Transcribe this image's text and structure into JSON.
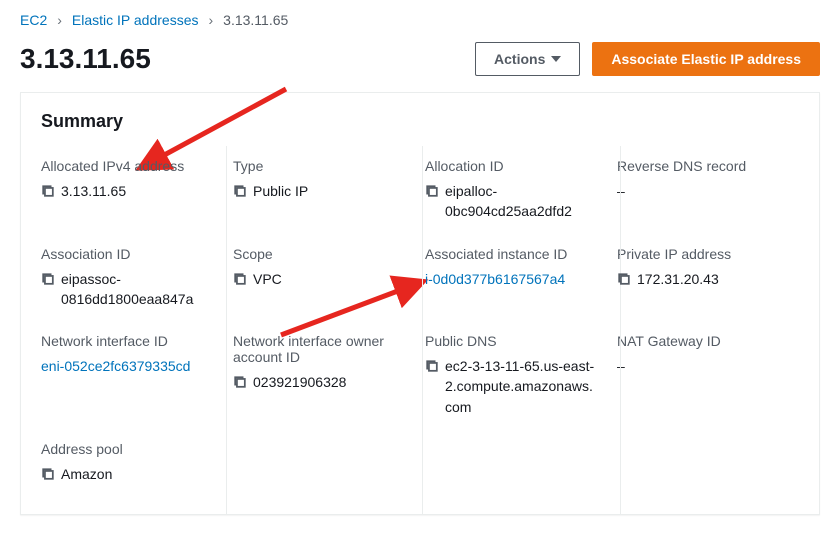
{
  "breadcrumb": {
    "items": [
      {
        "label": "EC2",
        "link": true
      },
      {
        "label": "Elastic IP addresses",
        "link": true
      },
      {
        "label": "3.13.11.65",
        "link": false
      }
    ]
  },
  "header": {
    "title": "3.13.11.65",
    "actions_label": "Actions",
    "associate_label": "Associate Elastic IP address"
  },
  "summary": {
    "title": "Summary",
    "fields": {
      "allocated_ipv4": {
        "label": "Allocated IPv4 address",
        "value": "3.13.11.65",
        "copy": true
      },
      "type": {
        "label": "Type",
        "value": "Public IP",
        "copy": true
      },
      "allocation_id": {
        "label": "Allocation ID",
        "value": "eipalloc-0bc904cd25aa2dfd2",
        "copy": true
      },
      "reverse_dns": {
        "label": "Reverse DNS record",
        "value": "–",
        "copy": false
      },
      "association_id": {
        "label": "Association ID",
        "value": "eipassoc-0816dd1800eaa847a",
        "copy": true
      },
      "scope": {
        "label": "Scope",
        "value": "VPC",
        "copy": true
      },
      "associated_instance": {
        "label": "Associated instance ID",
        "value": "i-0d0d377b6167567a4",
        "copy": false,
        "link": true
      },
      "private_ip": {
        "label": "Private IP address",
        "value": "172.31.20.43",
        "copy": true
      },
      "eni_id": {
        "label": "Network interface ID",
        "value": "eni-052ce2fc6379335cd",
        "copy": false,
        "link": true
      },
      "eni_owner": {
        "label": "Network interface owner account ID",
        "value": "023921906328",
        "copy": true
      },
      "public_dns": {
        "label": "Public DNS",
        "value": "ec2-3-13-11-65.us-east-2.compute.amazonaws.com",
        "copy": true
      },
      "nat_gw": {
        "label": "NAT Gateway ID",
        "value": "–",
        "copy": false
      },
      "address_pool": {
        "label": "Address pool",
        "value": "Amazon",
        "copy": true
      }
    }
  }
}
